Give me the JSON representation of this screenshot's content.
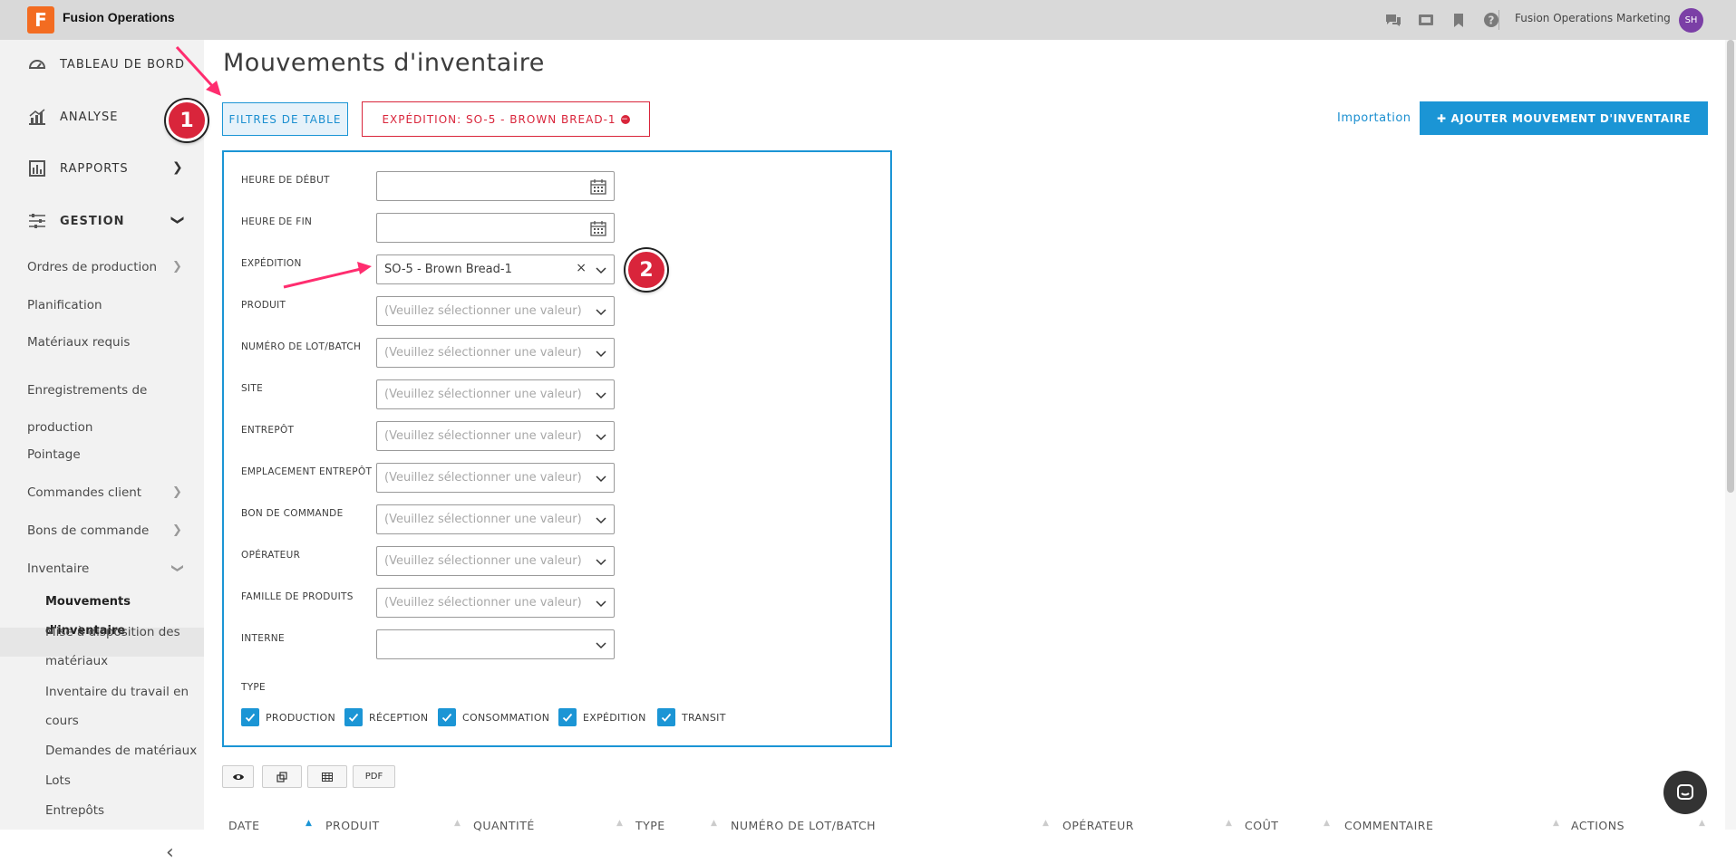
{
  "topbar": {
    "logo_letter": "F",
    "app_name": "Fusion Operations",
    "org_name": "Fusion Operations Marketing",
    "avatar_initials": "SH",
    "icons": [
      "chat-icon",
      "video-icon",
      "bookmark-icon",
      "help-icon"
    ]
  },
  "sidebar": {
    "main": [
      {
        "label": "TABLEAU DE BORD",
        "icon": "dashboard-icon"
      },
      {
        "label": "ANALYSE",
        "icon": "analytics-icon"
      },
      {
        "label": "RAPPORTS",
        "icon": "reports-icon"
      },
      {
        "label": "GESTION",
        "icon": "sliders-icon"
      }
    ],
    "items": [
      "Ordres de production",
      "Planification",
      "Matériaux requis",
      "Enregistrements de production",
      "Pointage",
      "Commandes client",
      "Bons de commande",
      "Inventaire"
    ],
    "sub_items": [
      "Mouvements d'inventaire",
      "Mise à disposition des matériaux",
      "Inventaire du travail en cours",
      "Demandes de matériaux",
      "Lots",
      "Entrepôts"
    ]
  },
  "page": {
    "title": "Mouvements d'inventaire",
    "filters_button": "FILTRES DE TABLE",
    "active_filter": "EXPÉDITION: SO-5 - BROWN BREAD-1",
    "import_link": "Importation",
    "add_button": "AJOUTER MOUVEMENT D'INVENTAIRE"
  },
  "filters": {
    "start_time_label": "HEURE DE DÉBUT",
    "end_time_label": "HEURE DE FIN",
    "shipment_label": "EXPÉDITION",
    "shipment_value": "SO-5 - Brown Bread-1",
    "placeholder": "(Veuillez sélectionner une valeur)",
    "product_label": "PRODUIT",
    "lot_label": "NUMÉRO DE LOT/BATCH",
    "site_label": "SITE",
    "warehouse_label": "ENTREPÔT",
    "location_label": "EMPLACEMENT ENTREPÔT",
    "po_label": "BON DE COMMANDE",
    "operator_label": "OPÉRATEUR",
    "family_label": "FAMILLE DE PRODUITS",
    "internal_label": "INTERNE",
    "type_label": "TYPE",
    "types": [
      "PRODUCTION",
      "RÉCEPTION",
      "CONSOMMATION",
      "EXPÉDITION",
      "TRANSIT"
    ]
  },
  "toolbar": {
    "pdf": "PDF"
  },
  "table": {
    "columns": [
      "DATE",
      "PRODUIT",
      "QUANTITÉ",
      "TYPE",
      "NUMÉRO DE LOT/BATCH",
      "OPÉRATEUR",
      "COÛT",
      "COMMENTAIRE",
      "ACTIONS"
    ]
  },
  "annotations": {
    "marker1": "1",
    "marker2": "2"
  },
  "colors": {
    "accent": "#1b95d5",
    "danger": "#d9253b",
    "brand": "#f36c21"
  }
}
